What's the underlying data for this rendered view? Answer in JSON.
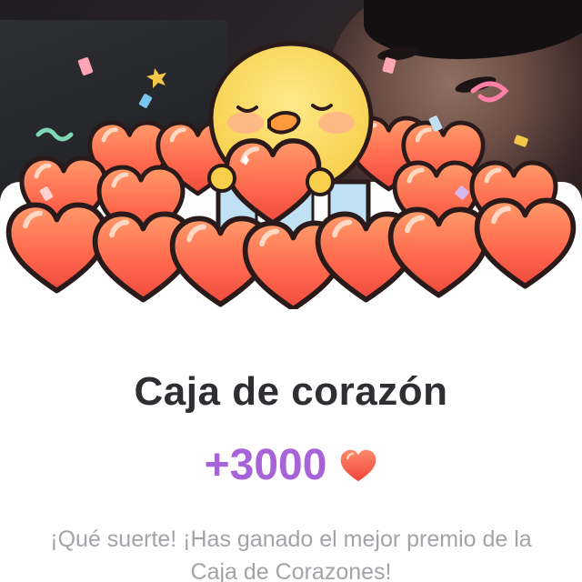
{
  "reward": {
    "title": "Caja de corazón",
    "amount": "+3000",
    "amount_icon": "heart-icon",
    "message": "¡Qué suerte! ¡Has ganado el mejor premio de la Caja de Corazones!"
  },
  "colors": {
    "amount": "#a763d8",
    "title": "#2f2f33",
    "message": "#a3a3a8",
    "heart": "#ff5b4a"
  }
}
